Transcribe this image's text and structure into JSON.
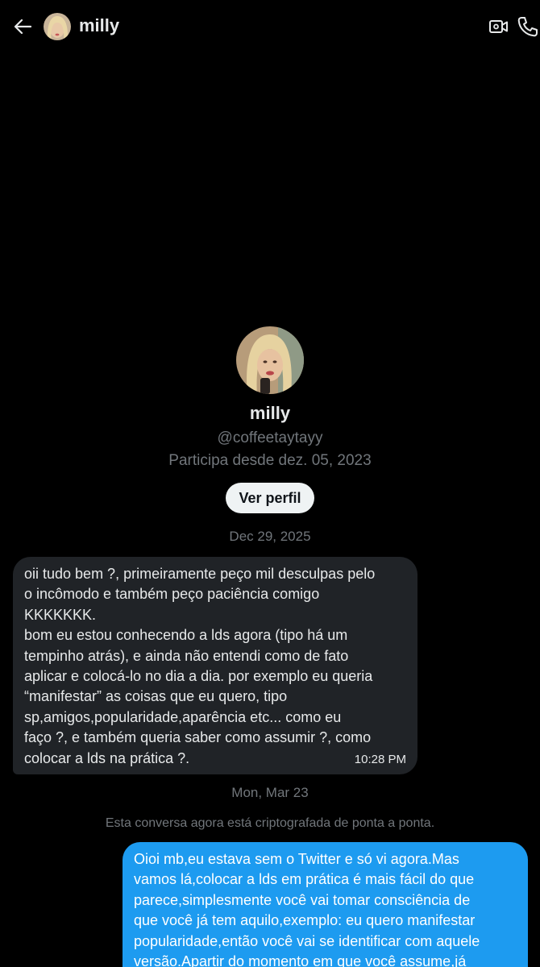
{
  "header": {
    "name": "milly",
    "icons": [
      "back-arrow-icon",
      "video-call-icon",
      "phone-icon"
    ]
  },
  "profile": {
    "name": "milly",
    "handle": "@coffeetaytayy",
    "joined": "Participa desde dez. 05, 2023",
    "view_profile_label": "Ver perfil"
  },
  "conversation": {
    "date_1": "Dec 29, 2025",
    "message_1": {
      "text": "oii tudo bem ?, primeiramente peço mil desculpas pelo\no incômodo e também peço paciência comigo\nKKKKKKK.\nbom eu estou conhecendo a lds agora (tipo há um\ntempinho atrás), e ainda não entendi como de fato\naplicar e colocá-lo no dia a dia. por exemplo eu queria\n“manifestar” as coisas que eu quero, tipo\nsp,amigos,popularidade,aparência etc... como eu\nfaço ?, e também queria saber como assumir ?, como\ncolocar a lds na prática ?.",
      "time": "10:28 PM"
    },
    "date_2": "Mon, Mar 23",
    "encryption_notice": "Esta conversa agora está criptografada de ponta a ponta.",
    "message_2": {
      "text": "Oioi mb,eu estava sem o Twitter e só vi agora.Mas\nvamos lá,colocar a lds em prática é mais fácil do que\nparece,simplesmente você vai tomar consciência de\nque você já tem aquilo,exemplo: eu quero manifestar\npopularidade,então você vai se identificar com aquele\nversão.Apartir do momento em que você assume,já"
    }
  },
  "colors": {
    "background": "#000000",
    "incoming_bubble": "#202327",
    "outgoing_bubble": "#1d9bf0",
    "secondary_text": "#71767b"
  }
}
